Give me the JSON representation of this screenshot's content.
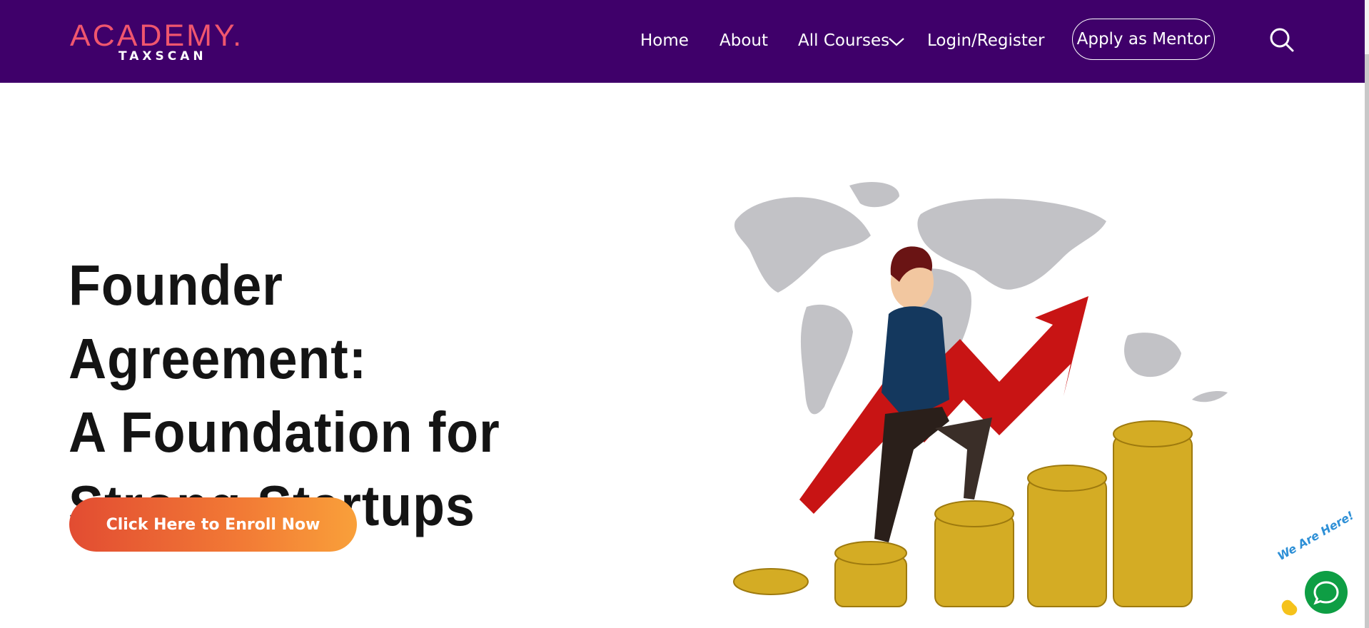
{
  "header": {
    "logo_main": "ACADEMY.",
    "logo_sub": "TAXSCAN",
    "nav": [
      {
        "label": "Home"
      },
      {
        "label": "About"
      },
      {
        "label": "All Courses"
      },
      {
        "label": "Login/Register"
      }
    ],
    "cta_label": "Apply as Mentor"
  },
  "hero": {
    "title_line1": "Founder Agreement:",
    "title_line2": "A Foundation for",
    "title_line3": "Strong Startups",
    "enroll_label": "Click Here to Enroll Now"
  },
  "chat": {
    "badge_text": "We Are Here!"
  },
  "colors": {
    "navbar_bg": "#3f006a",
    "logo_accent": "#f0566e",
    "cta_gradient_start": "#e24c32",
    "cta_gradient_end": "#f9a03a",
    "chat_green": "#0e9e44"
  },
  "icons": {
    "search": "search-icon",
    "dropdown": "chevron-down-icon",
    "chat": "chat-bubble-icon",
    "wave": "waving-hand-icon"
  }
}
